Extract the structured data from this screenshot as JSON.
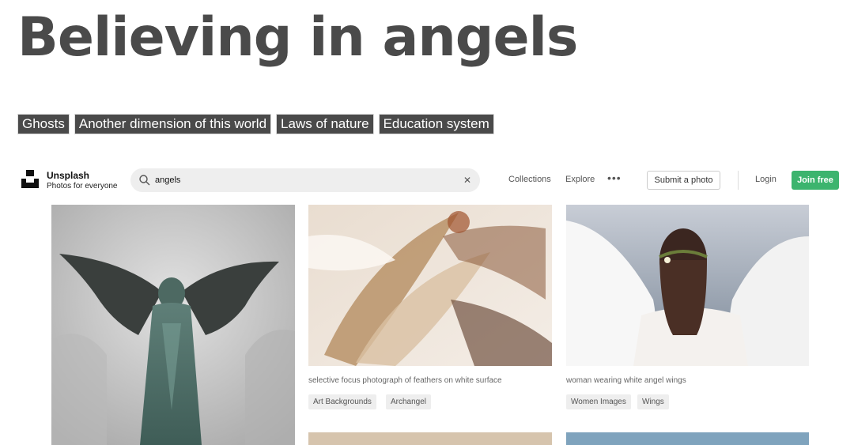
{
  "page": {
    "title": "Believing in angels",
    "tags": [
      "Ghosts",
      "Another dimension of this world",
      "Laws of nature",
      "Education system"
    ]
  },
  "unsplash": {
    "brand_name": "Unsplash",
    "brand_tagline": "Photos for everyone",
    "search": {
      "value": "angels"
    },
    "nav": {
      "collections": "Collections",
      "explore": "Explore",
      "submit": "Submit a photo",
      "login": "Login",
      "join": "Join free"
    },
    "colors": {
      "join_button": "#3cb46e",
      "title_gray": "#4a4a4a"
    },
    "photos": [
      {
        "id": "angel-statue",
        "caption": "",
        "tags": []
      },
      {
        "id": "feathers",
        "caption": "selective focus photograph of feathers on white surface",
        "tags": [
          "Art Backgrounds",
          "Archangel"
        ]
      },
      {
        "id": "angel-wings",
        "caption": "woman wearing white angel wings",
        "tags": [
          "Women Images",
          "Wings"
        ]
      }
    ]
  }
}
